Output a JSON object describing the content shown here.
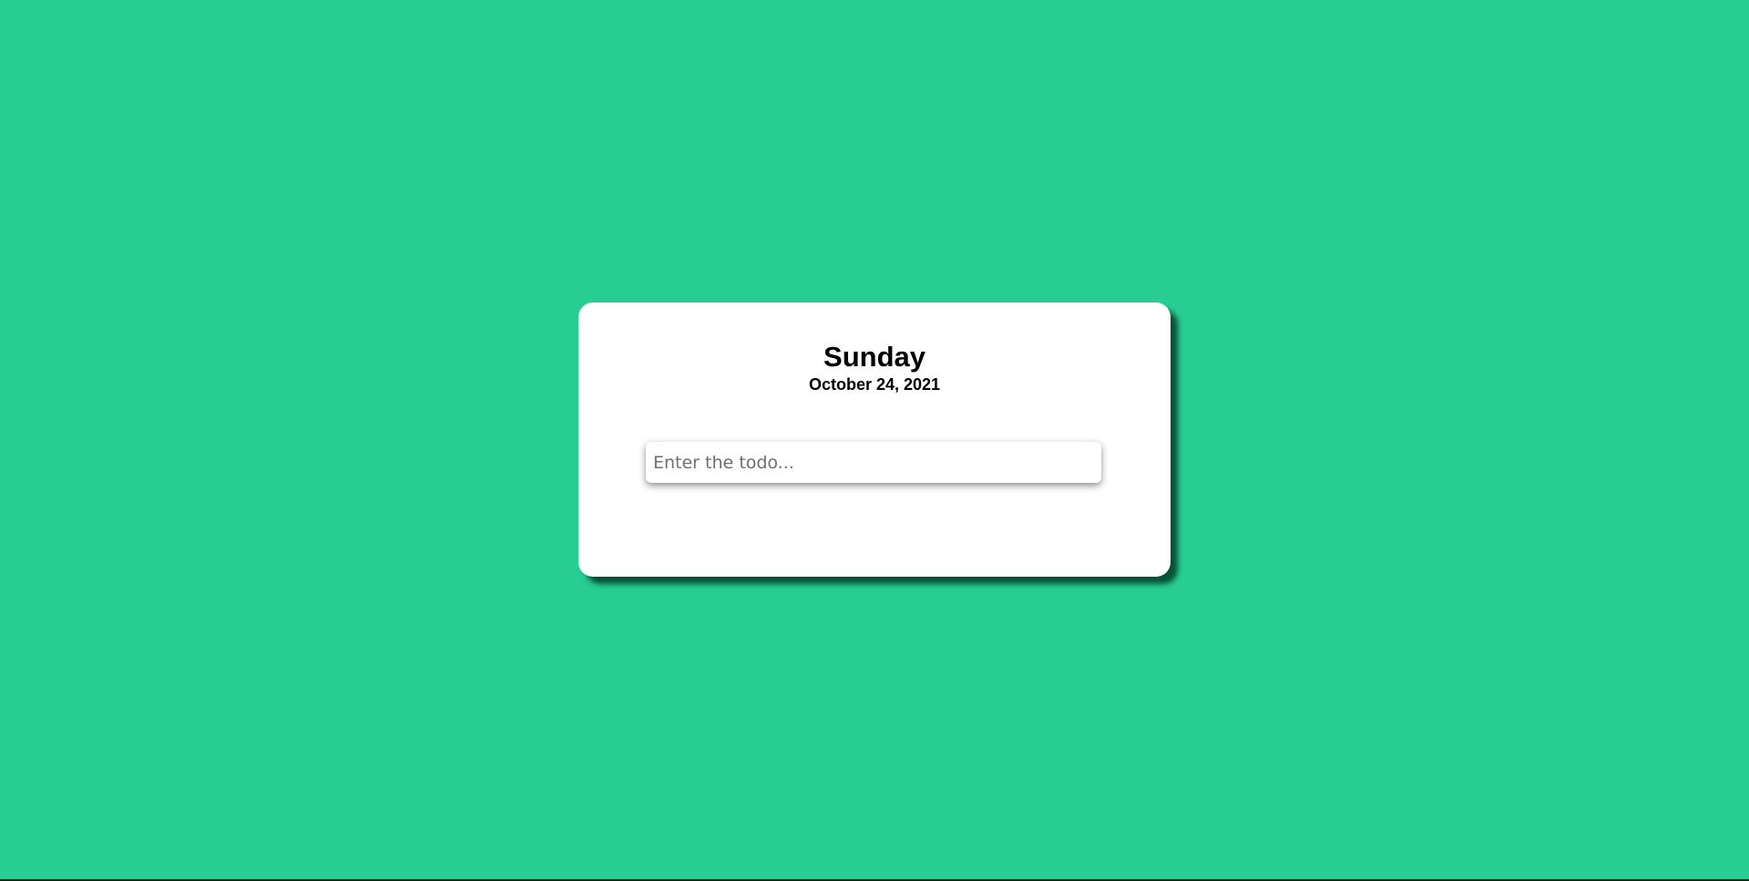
{
  "header": {
    "day": "Sunday",
    "date": "October 24, 2021"
  },
  "todo_input": {
    "placeholder": "Enter the todo...",
    "value": ""
  },
  "colors": {
    "background": "#28cd93",
    "card": "#ffffff",
    "text": "#000000"
  }
}
